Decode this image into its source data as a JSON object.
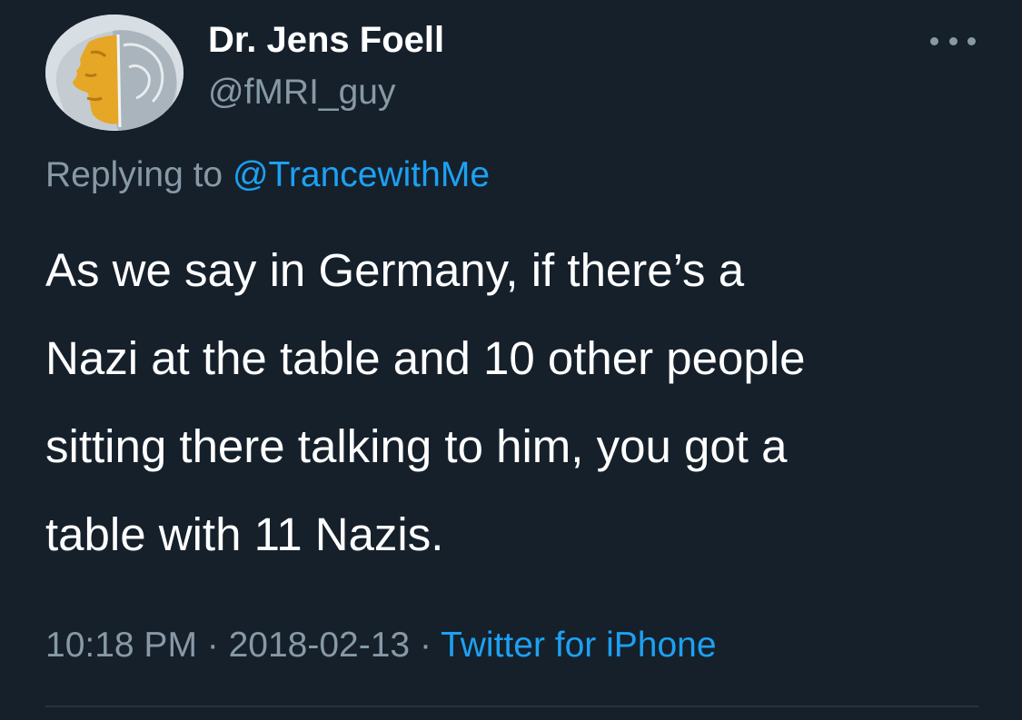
{
  "author": {
    "name": "Dr. Jens Foell",
    "handle": "@fMRI_guy",
    "avatar_icon": "brain-scan-head-avatar"
  },
  "menu": {
    "icon": "more-options-icon"
  },
  "reply": {
    "prefix": "Replying to ",
    "mention": "@TrancewithMe"
  },
  "tweet": {
    "lines": [
      "As we say in Germany, if there’s a",
      "Nazi at the table and 10 other people",
      "sitting there talking to him, you got a",
      "table with 11 Nazis."
    ]
  },
  "meta": {
    "time": "10:18 PM",
    "separator": " · ",
    "date": "2018-02-13",
    "source": "Twitter for iPhone"
  },
  "colors": {
    "background": "#15202b",
    "primary_text": "#ffffff",
    "secondary_text": "#8899a6",
    "link": "#1da1f2",
    "divider": "#253341"
  }
}
